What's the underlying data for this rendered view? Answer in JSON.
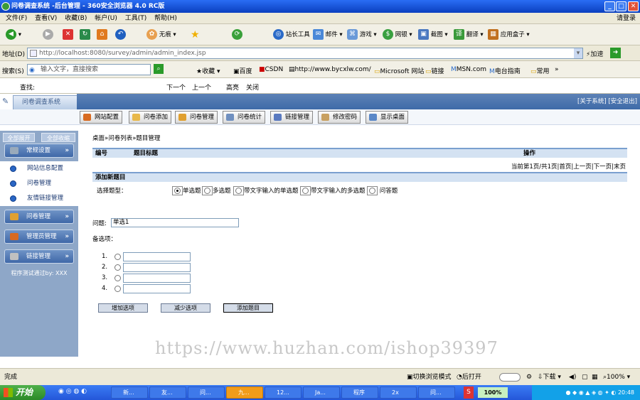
{
  "window": {
    "title": "问卷调查系统 -后台管理 - 360安全浏览器 4.0 RC版",
    "right_link": "请登录"
  },
  "menu": [
    "文件(F)",
    "查看(V)",
    "收藏(B)",
    "帐户(U)",
    "工具(T)",
    "帮助(H)"
  ],
  "toolbar": {
    "ad_block": "无痕",
    "items": [
      "站长工具",
      "邮件",
      "游戏",
      "网银",
      "截图",
      "翻译",
      "应用盒子"
    ]
  },
  "address": {
    "label": "地址(D)",
    "url": "http://localhost:8080/survey/admin/admin_index.jsp",
    "go": "加速"
  },
  "search": {
    "label": "搜索(S)",
    "placeholder": "输入文字，直接搜索",
    "bookmarks": [
      "收藏",
      "百度",
      "CSDN",
      "http://www.bycxlw.com/",
      "Microsoft 网站",
      "链接",
      "MSN.com",
      "电台指南",
      "常用"
    ],
    "more": "»"
  },
  "findbar": {
    "label": "查找:",
    "next": "下一个",
    "prev": "上一个",
    "highlight": "高亮",
    "close": "关闭"
  },
  "app": {
    "system_name": "问卷调查系统",
    "top_links": "[关于系统] [安全退出]",
    "nav": [
      "网站配置",
      "问卷添加",
      "问卷管理",
      "问卷统计",
      "链接管理",
      "修改密码",
      "显示桌面"
    ],
    "sidebar": {
      "expand_all": "全部展开",
      "collapse_all": "全部收缩",
      "sections": [
        {
          "label": "常规设置",
          "items": [
            "网站信息配置",
            "问卷管理",
            "友情链接管理"
          ]
        },
        {
          "label": "问卷管理",
          "items": []
        },
        {
          "label": "管理员管理",
          "items": []
        },
        {
          "label": "链接管理",
          "items": []
        }
      ],
      "footer": "程序测试通过by: XXX"
    },
    "breadcrumb": "桌面»问卷列表»题目管理",
    "table_headers": {
      "id": "编号",
      "title": "题目标题",
      "action": "操作"
    },
    "pager": "当前第1页/共1页|首页|上一页|下一页|末页",
    "add_section": "添加新题目",
    "type_label": "选择题型：",
    "types": [
      {
        "label": "单选题",
        "checked": true
      },
      {
        "label": "多选题",
        "checked": false
      },
      {
        "label": "带文字输入的单选题",
        "checked": false
      },
      {
        "label": "带文字输入的多选题",
        "checked": false
      },
      {
        "label": "问答题",
        "checked": false
      }
    ],
    "question_label": "问题:",
    "question_value": "单选1",
    "options_label": "备选项：",
    "options": [
      "1.",
      "2.",
      "3.",
      "4."
    ],
    "buttons": {
      "add_option": "增加选项",
      "remove_option": "减少选项",
      "add_question": "添加题目"
    }
  },
  "watermark": "https://www.huzhan.com/ishop39397",
  "status": {
    "left": "完成",
    "mode": "切换浏览模式",
    "open": "后打开",
    "download": "下载",
    "zoom": "100%"
  },
  "taskbar": {
    "start": "开始",
    "tasks": [
      "新...",
      "友...",
      "问...",
      "九...",
      "12...",
      "Ja...",
      "程序",
      "2x",
      "问..."
    ],
    "tray_zoom": "100%",
    "clock": "20:48"
  }
}
